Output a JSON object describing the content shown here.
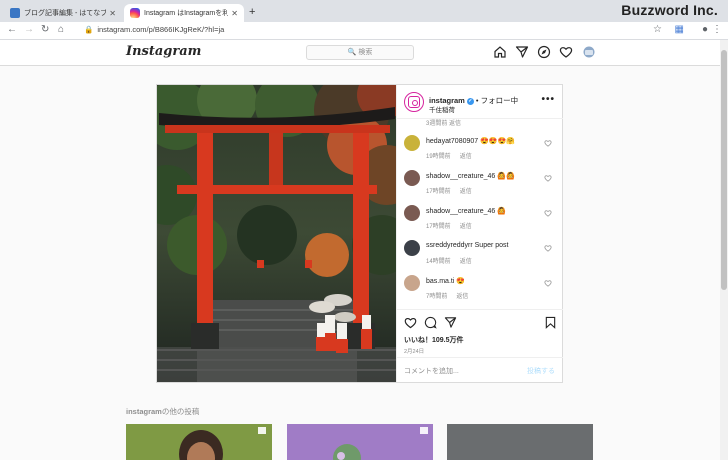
{
  "browser": {
    "tabs": [
      {
        "title": "ブログ記事編集 - はてなブログ",
        "active": false
      },
      {
        "title": "Instagram はInstagramを利用して",
        "active": true
      }
    ],
    "new_tab": "+",
    "url": "instagram.com/p/B866IKJgReK/?hl=ja",
    "brand_logo": "Buzzword Inc."
  },
  "header": {
    "logo": "Instagram",
    "search_placeholder": "🔍 検索"
  },
  "post": {
    "account": "instagram",
    "follow_status": "• フォロー中",
    "location": "千住稲荷",
    "more": "•••",
    "truncated_meta": "3週間前   返信",
    "comments": [
      {
        "user": "hedayat7080907",
        "text": "😍😍😍🤗",
        "time": "19時間前",
        "reply": "返信",
        "avatar_color": "#c9b23a"
      },
      {
        "user": "shadow__creature_46",
        "text": "🙆🙆",
        "time": "17時間前",
        "reply": "返信",
        "avatar_color": "#7a5a52"
      },
      {
        "user": "shadow__creature_46",
        "text": "🙆",
        "time": "17時間前",
        "reply": "返信",
        "avatar_color": "#7a5a52"
      },
      {
        "user": "ssreddyreddyrr",
        "text": "Super post",
        "time": "14時間前",
        "reply": "返信",
        "avatar_color": "#3b4048"
      },
      {
        "user": "bas.ma.ti",
        "text": "😍",
        "time": "7時間前",
        "reply": "返信",
        "avatar_color": "#c8a58c"
      }
    ],
    "likes": "いいね！109.5万件",
    "date": "2月24日",
    "add_comment_placeholder": "コメントを追加...",
    "post_button": "投稿する"
  },
  "more_posts": {
    "account": "instagram",
    "suffix": "の他の投稿"
  },
  "colors": {
    "torii_red": "#d8391f",
    "link_blue": "#3897f0",
    "chrome_gray": "#dee1e6"
  }
}
